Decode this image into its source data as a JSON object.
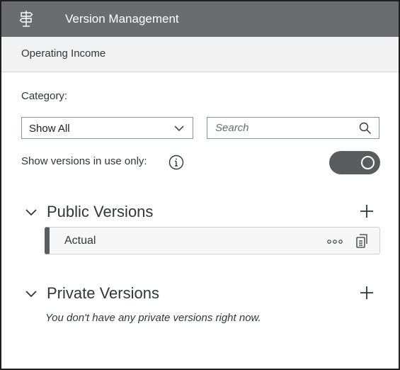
{
  "header": {
    "title": "Version Management",
    "icon": "signpost-icon"
  },
  "subheader": {
    "title": "Operating Income"
  },
  "filters": {
    "category_label": "Category:",
    "category_value": "Show All",
    "search_placeholder": "Search",
    "show_in_use_label": "Show versions in use only:",
    "show_in_use_enabled": true
  },
  "public_versions": {
    "title": "Public Versions",
    "items": [
      {
        "label": "Actual"
      }
    ]
  },
  "private_versions": {
    "title": "Private Versions",
    "empty_message": "You don't have any private versions right now."
  },
  "colors": {
    "header_bg": "#6a6d70",
    "toggle_on": "#595b5e",
    "row_accent": "#5b5d60"
  }
}
